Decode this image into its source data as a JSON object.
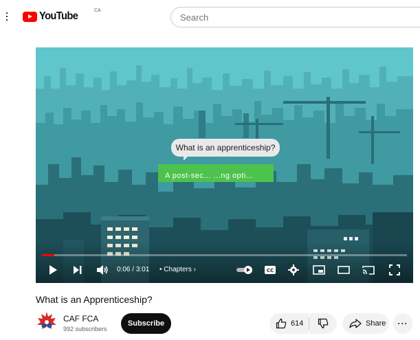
{
  "masthead": {
    "logo_text": "YouTube",
    "country_code": "CA",
    "search_placeholder": "Search"
  },
  "player": {
    "caption_bubble": "What is an apprenticeship?",
    "green_caption": "A post-sec... ...ng opti...",
    "time_current": "0:06",
    "time_separator": " / ",
    "time_total": "3:01",
    "chapters_label": "• Chapters ›",
    "progress_fraction": 0.033,
    "colors": {
      "progress": "#ff0000",
      "sky": "#5fc6cc",
      "green": "#4dc24d"
    }
  },
  "video": {
    "title": "What is an Apprenticeship?"
  },
  "channel": {
    "name": "CAF FCA",
    "subscribers": "992 subscribers",
    "subscribe_label": "Subscribe"
  },
  "actions": {
    "like_count": "614",
    "share_label": "Share",
    "more_label": "···"
  }
}
